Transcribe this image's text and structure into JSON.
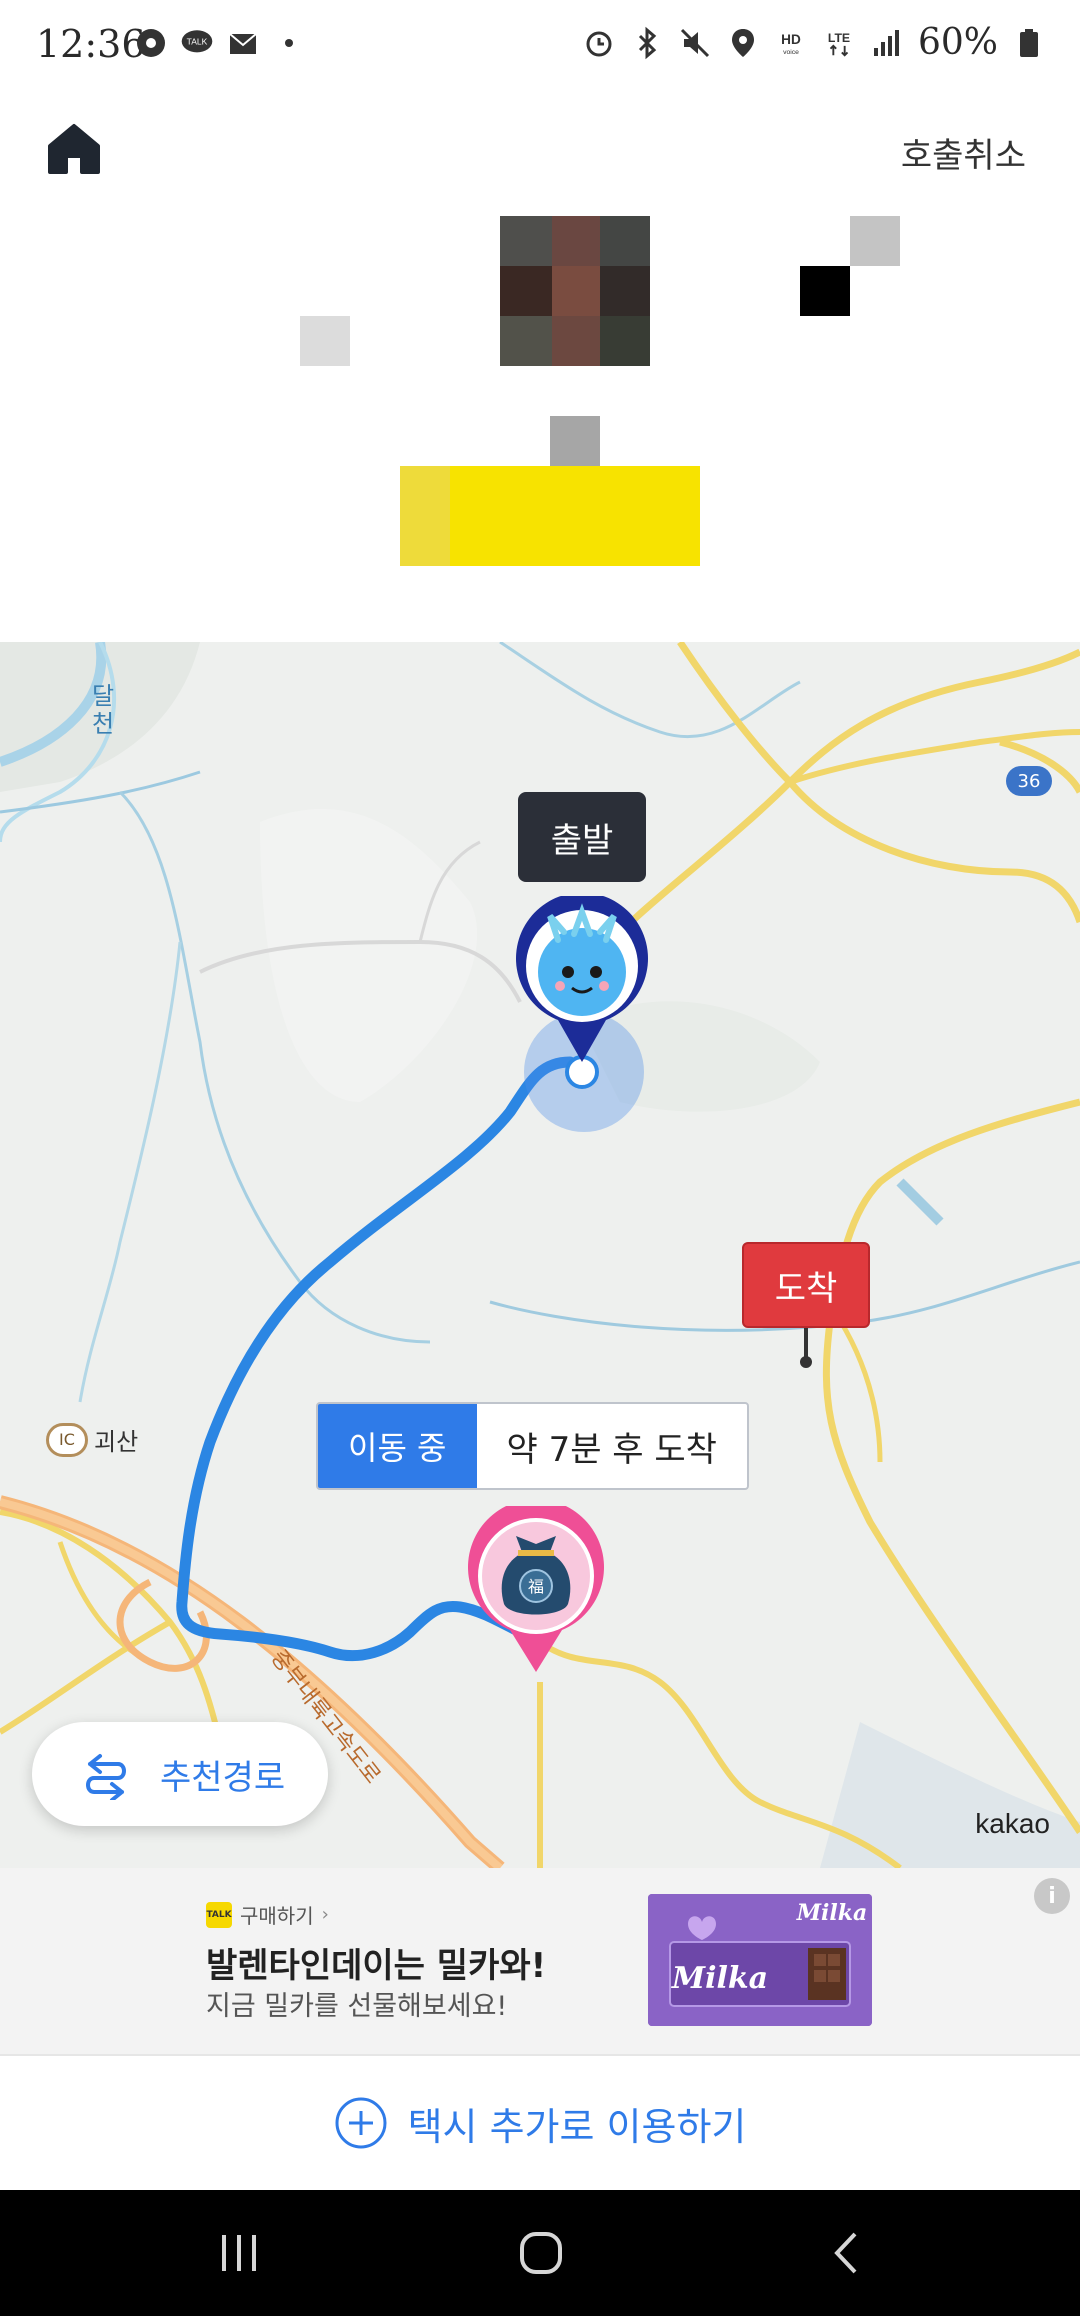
{
  "status_bar": {
    "time": "12:36",
    "battery": "60%",
    "left_icons": [
      "soccer-icon",
      "talk-icon",
      "mail-icon",
      "dot-icon"
    ],
    "right_icons": [
      "alarm-icon",
      "bluetooth-icon",
      "mute-icon",
      "location-icon",
      "hd-voice-icon",
      "lte-icon",
      "signal-icon",
      "battery-icon"
    ]
  },
  "header": {
    "cancel_label": "호출취소"
  },
  "map": {
    "start_label": "출발",
    "arrive_label": "도착",
    "status_moving": "이동 중",
    "status_eta": "약 7분 후 도착",
    "route_button_label": "추천경로",
    "provider": "kakao",
    "place_labels": {
      "stream": "달천",
      "ic_badge": "IC",
      "ic_name": "괴산",
      "highway": "중부내륙고속도로",
      "road_number": "36"
    }
  },
  "ad": {
    "talk_badge": "TALK",
    "talk_label": "구매하기",
    "title": "발렌타인데이는 밀카와!",
    "subtitle": "지금 밀카를 선물해보세요!",
    "brand": "Milka",
    "info_icon": "i"
  },
  "bottom": {
    "add_taxi_label": "택시 추가로 이용하기"
  },
  "colors": {
    "accent": "#2f7be8",
    "arrive": "#e03a3e",
    "highlight": "#f7e300"
  }
}
